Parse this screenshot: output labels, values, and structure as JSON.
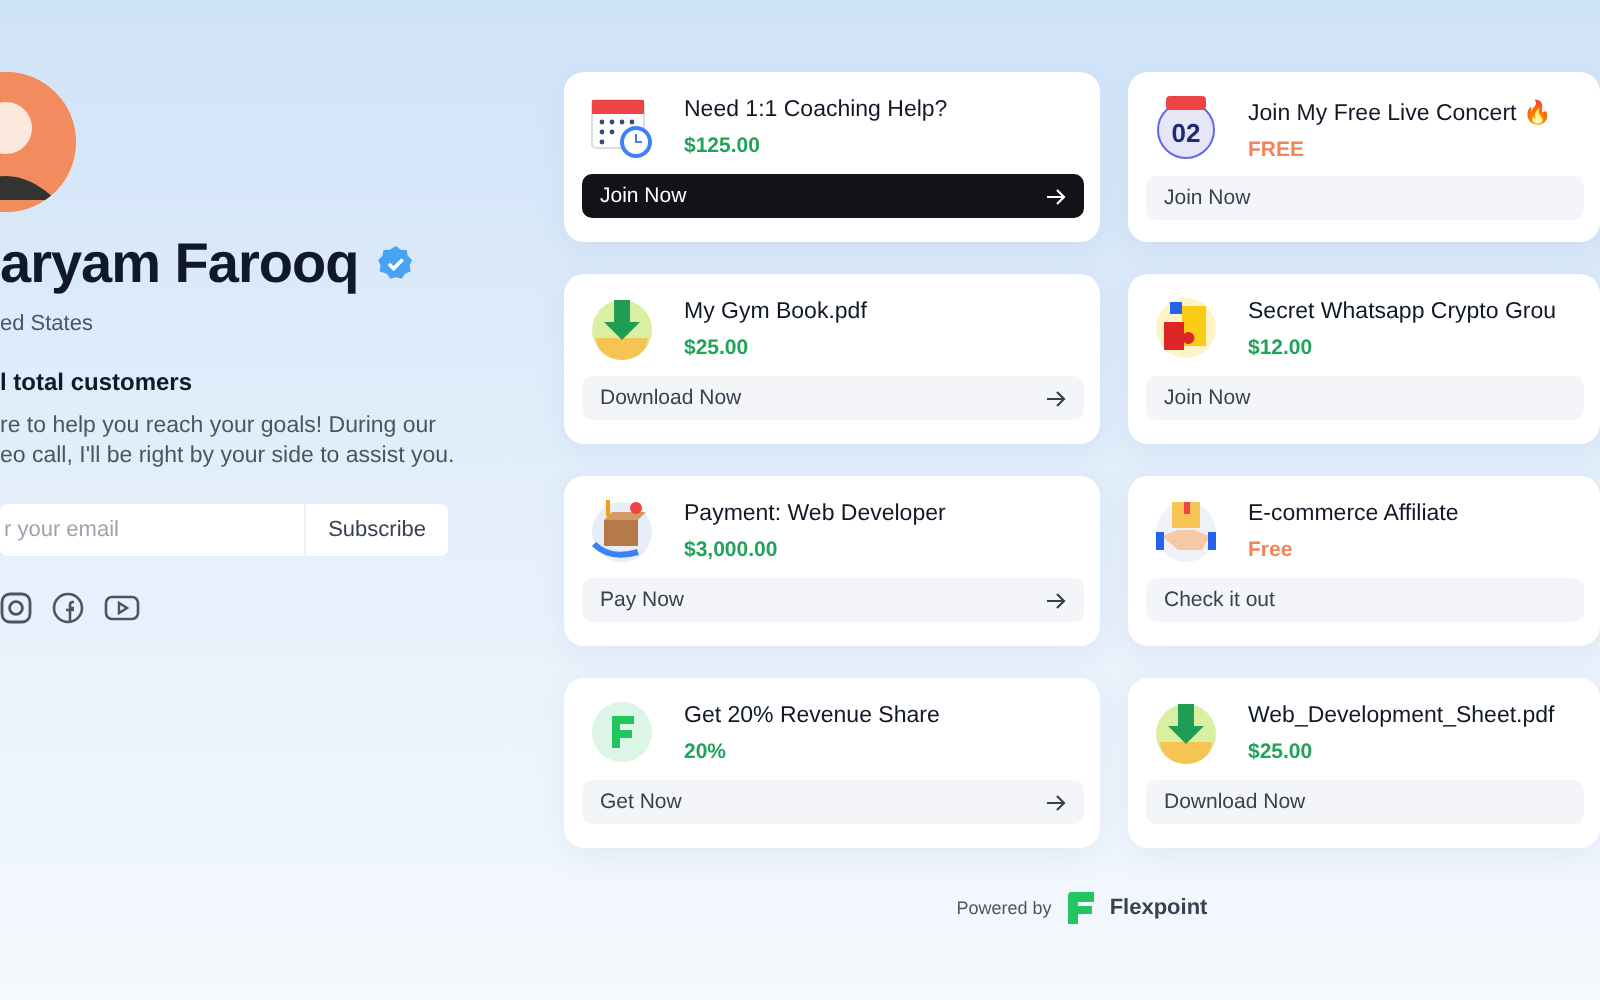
{
  "profile": {
    "name": "aryam Farooq",
    "verified": true,
    "location": "ed States",
    "customers": "l total customers",
    "bio": "re to help you reach your goals! During our\neo call, I'll be right by your side to assist you.",
    "email_placeholder": "r your email",
    "subscribe": "Subscribe"
  },
  "offers": [
    {
      "kind": "calendar",
      "title": "Need 1:1 Coaching Help?",
      "price": "$125.00",
      "color": "#22a35a",
      "action": "Join Now",
      "primary": true,
      "arrow": true
    },
    {
      "kind": "date",
      "date_number": "02",
      "title": "Join My Free Live Concert 🔥",
      "price": "FREE",
      "color": "#f2845c",
      "action": "Join Now",
      "primary": false,
      "arrow": false
    },
    {
      "kind": "download",
      "title": "My Gym Book.pdf",
      "price": "$25.00",
      "color": "#22a35a",
      "action": "Download Now",
      "primary": false,
      "arrow": true
    },
    {
      "kind": "puzzle",
      "title": "Secret Whatsapp Crypto Grou",
      "price": "$12.00",
      "color": "#22a35a",
      "action": "Join Now",
      "primary": false,
      "arrow": false
    },
    {
      "kind": "parcel",
      "title": "Payment: Web Developer",
      "price": "$3,000.00",
      "color": "#22a35a",
      "action": "Pay Now",
      "primary": false,
      "arrow": true
    },
    {
      "kind": "handshake",
      "title": "E-commerce Affiliate",
      "price": "Free",
      "color": "#f2845c",
      "action": "Check it out",
      "primary": false,
      "arrow": false
    },
    {
      "kind": "logo",
      "title": "Get 20% Revenue Share",
      "price": "20%",
      "color": "#22a35a",
      "action": "Get Now",
      "primary": false,
      "arrow": true
    },
    {
      "kind": "download",
      "title": "Web_Development_Sheet.pdf",
      "price": "$25.00",
      "color": "#22a35a",
      "action": "Download Now",
      "primary": false,
      "arrow": false
    }
  ],
  "footer": {
    "powered_by": "Powered by",
    "brand": "Flexpoint"
  }
}
